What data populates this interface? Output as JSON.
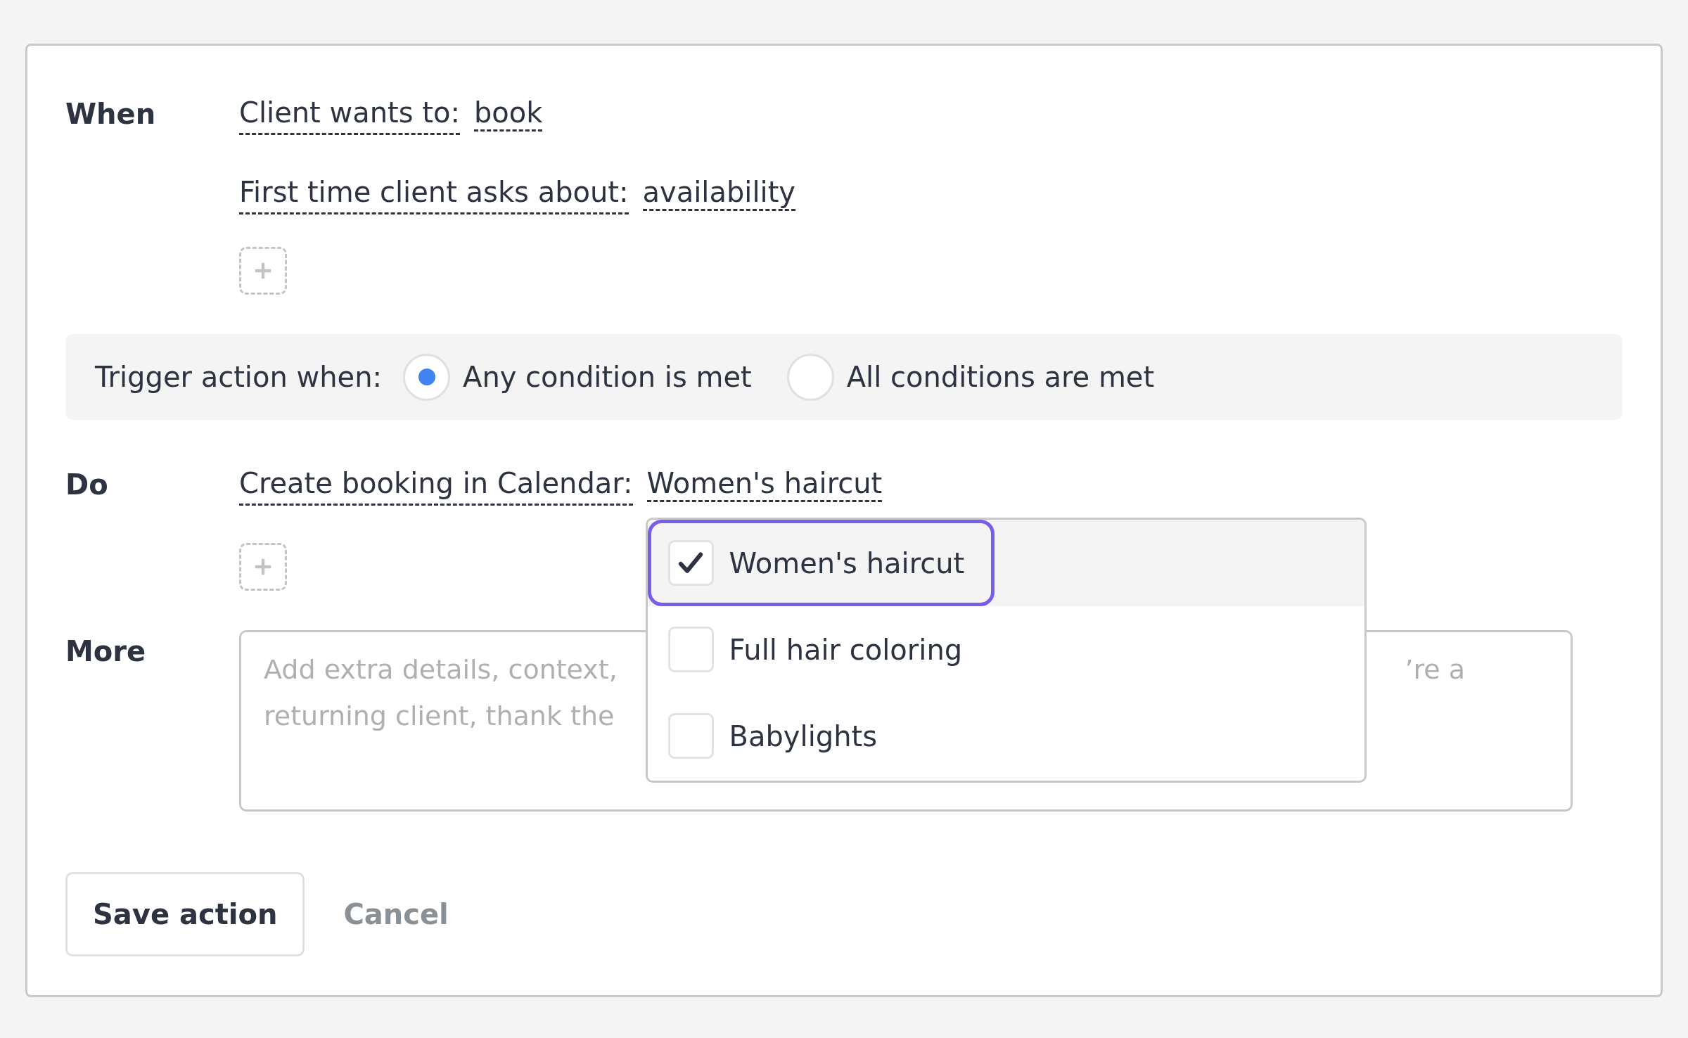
{
  "conditions": {
    "label": "When",
    "rows": [
      {
        "field": "Client wants to:",
        "value": "book"
      },
      {
        "field": "First time client asks about:",
        "value": "availability"
      }
    ]
  },
  "trigger": {
    "label": "Trigger action when:",
    "options": [
      {
        "label": "Any condition is met",
        "selected": true
      },
      {
        "label": "All conditions are met",
        "selected": false
      }
    ]
  },
  "actions": {
    "label": "Do",
    "rows": [
      {
        "field": "Create booking in Calendar:",
        "value": "Women's haircut"
      }
    ],
    "dropdown": {
      "options": [
        {
          "label": "Women's haircut",
          "checked": true,
          "focused": true
        },
        {
          "label": "Full hair coloring",
          "checked": false,
          "focused": false
        },
        {
          "label": "Babylights",
          "checked": false,
          "focused": false
        }
      ]
    }
  },
  "more": {
    "label": "More",
    "placeholder_lines": [
      {
        "left": "Add extra details, context,",
        "right": "’re a"
      },
      {
        "left": "returning client, thank the"
      }
    ]
  },
  "buttons": [
    {
      "label": "Save action",
      "kind": "primary"
    },
    {
      "label": "Cancel",
      "kind": "link"
    }
  ]
}
